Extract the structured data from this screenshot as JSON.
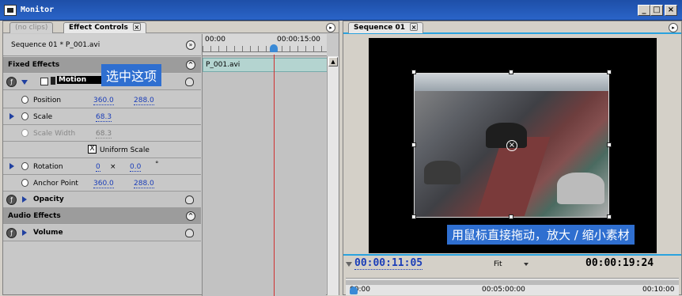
{
  "window": {
    "title": "Monitor",
    "min_label": "_",
    "max_label": "□",
    "close_label": "×"
  },
  "left_tabs": [
    {
      "label": "(no clips)"
    },
    {
      "label": "Effect Controls",
      "close": "×"
    }
  ],
  "sequence_label": "Sequence 01 * P_001.avi",
  "timeline": {
    "start": "00:00",
    "mid": "00:00:15:00",
    "clip_name": "P_001.avi"
  },
  "fixed_effects": {
    "header": "Fixed Effects",
    "motion_label": "Motion",
    "annotation": "选中这项"
  },
  "params": {
    "position": {
      "label": "Position",
      "x": "360.0",
      "y": "288.0"
    },
    "scale": {
      "label": "Scale",
      "value": "68.3"
    },
    "scale_width": {
      "label": "Scale Width",
      "value": "68.3"
    },
    "uniform_scale": {
      "label": "Uniform Scale",
      "checked_mark": "X"
    },
    "rotation": {
      "label": "Rotation",
      "turns": "0",
      "times": "×",
      "degrees": "0.0",
      "unit": "°"
    },
    "anchor_point": {
      "label": "Anchor Point",
      "x": "360.0",
      "y": "288.0"
    }
  },
  "opacity_label": "Opacity",
  "audio_effects": {
    "header": "Audio Effects",
    "volume_label": "Volume"
  },
  "monitor": {
    "tab_label": "Sequence 01",
    "tab_close": "×",
    "annotation": "用鼠标直接拖动，放大 / 缩小素材",
    "current_tc": "00:00:11:05",
    "fit_label": "Fit",
    "duration_tc": "00:00:19:24",
    "ruler": {
      "t0": "00:00",
      "t1": "00:05:00:00",
      "t2": "00:10:00"
    }
  },
  "colors": {
    "accent": "#2aa2de",
    "timecode_blue": "#1a3db8",
    "annotation_bg": "#2f6fd0",
    "playhead": "#d03030"
  }
}
